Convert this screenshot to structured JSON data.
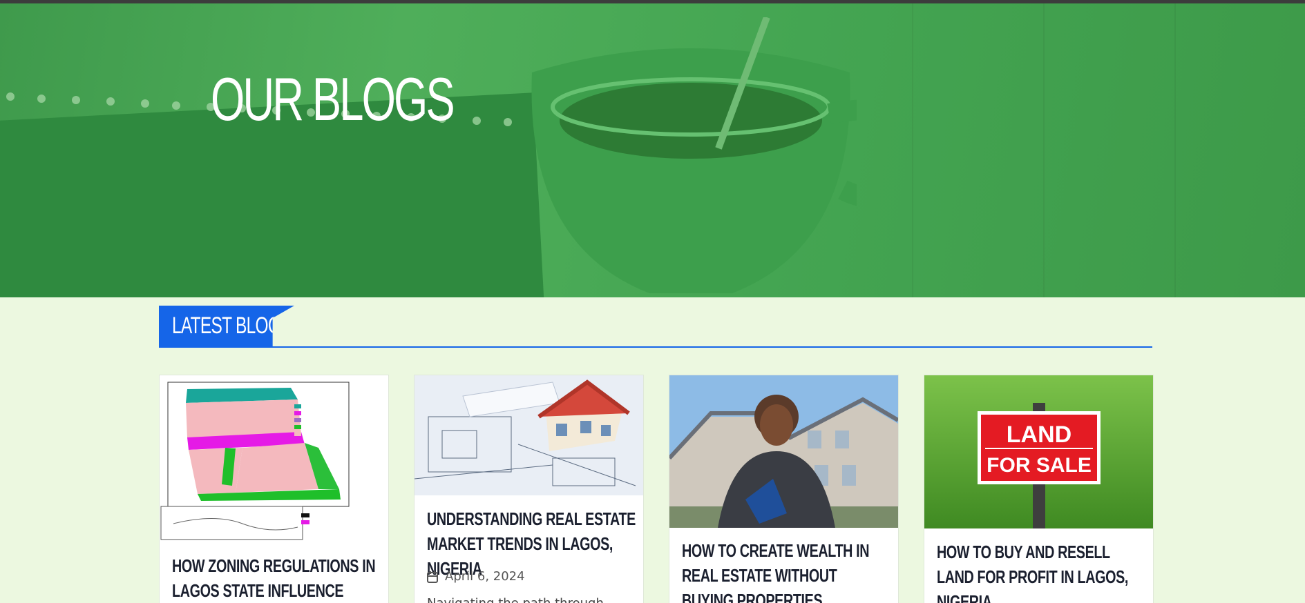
{
  "hero": {
    "title": "OUR BLOGS"
  },
  "section": {
    "title": "LATEST BLOGS"
  },
  "posts": [
    {
      "title": "HOW ZONING REGULATIONS IN LAGOS STATE INFLUENCE REAL",
      "image": "zoning-map-image"
    },
    {
      "title": "UNDERSTANDING REAL ESTATE MARKET TRENDS IN LAGOS, NIGERIA",
      "date": "April 6, 2024",
      "excerpt": "Navigating the path through",
      "image": "house-blueprint-image"
    },
    {
      "title": "HOW TO CREATE WEALTH IN REAL ESTATE WITHOUT BUYING PROPERTIES",
      "image": "agent-house-image"
    },
    {
      "title": "HOW TO BUY AND RESELL LAND FOR PROFIT IN LAGOS, NIGERIA",
      "image": "land-for-sale-image",
      "sign": {
        "line1": "LAND",
        "line2": "FOR SALE"
      }
    }
  ],
  "colors": {
    "accent": "#1565e8",
    "page_bg": "#ecf8e0",
    "hero_tint": "#4caf50"
  }
}
